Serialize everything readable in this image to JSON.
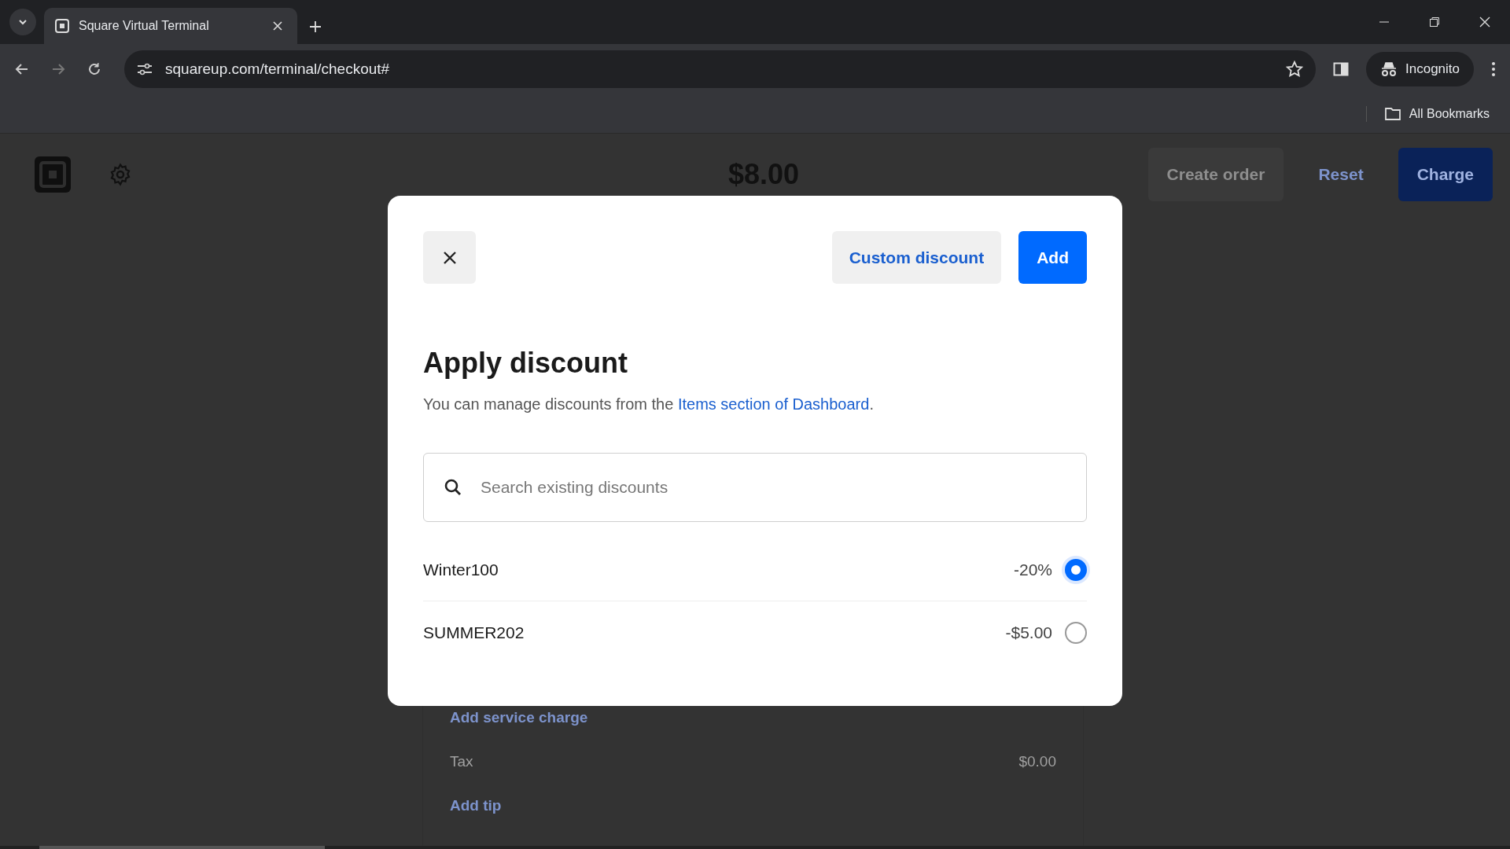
{
  "browser": {
    "tab_title": "Square Virtual Terminal",
    "url": "squareup.com/terminal/checkout#",
    "profile_label": "Incognito",
    "bookmarks_folder": "All Bookmarks"
  },
  "page": {
    "total": "$8.00",
    "actions": [
      {
        "label": "Create order",
        "kind": "ghost"
      },
      {
        "label": "Reset",
        "kind": "link"
      },
      {
        "label": "Charge",
        "kind": "primary"
      }
    ],
    "summary": [
      {
        "label": "Add service charge",
        "kind": "link"
      },
      {
        "label": "Tax",
        "value": "$0.00",
        "kind": "line"
      },
      {
        "label": "Add tip",
        "kind": "link"
      }
    ]
  },
  "modal": {
    "custom_button": "Custom discount",
    "add_button": "Add",
    "title": "Apply discount",
    "description": "You can manage discounts from the ",
    "description_link": "Items section of Dashboard",
    "description_end": ".",
    "search": {
      "placeholder": "Search existing discounts"
    },
    "discounts": [
      {
        "name": "Winter100",
        "amount": "-20%",
        "selected": true
      },
      {
        "name": "SUMMER202",
        "amount": "-$5.00",
        "selected": false
      }
    ]
  }
}
